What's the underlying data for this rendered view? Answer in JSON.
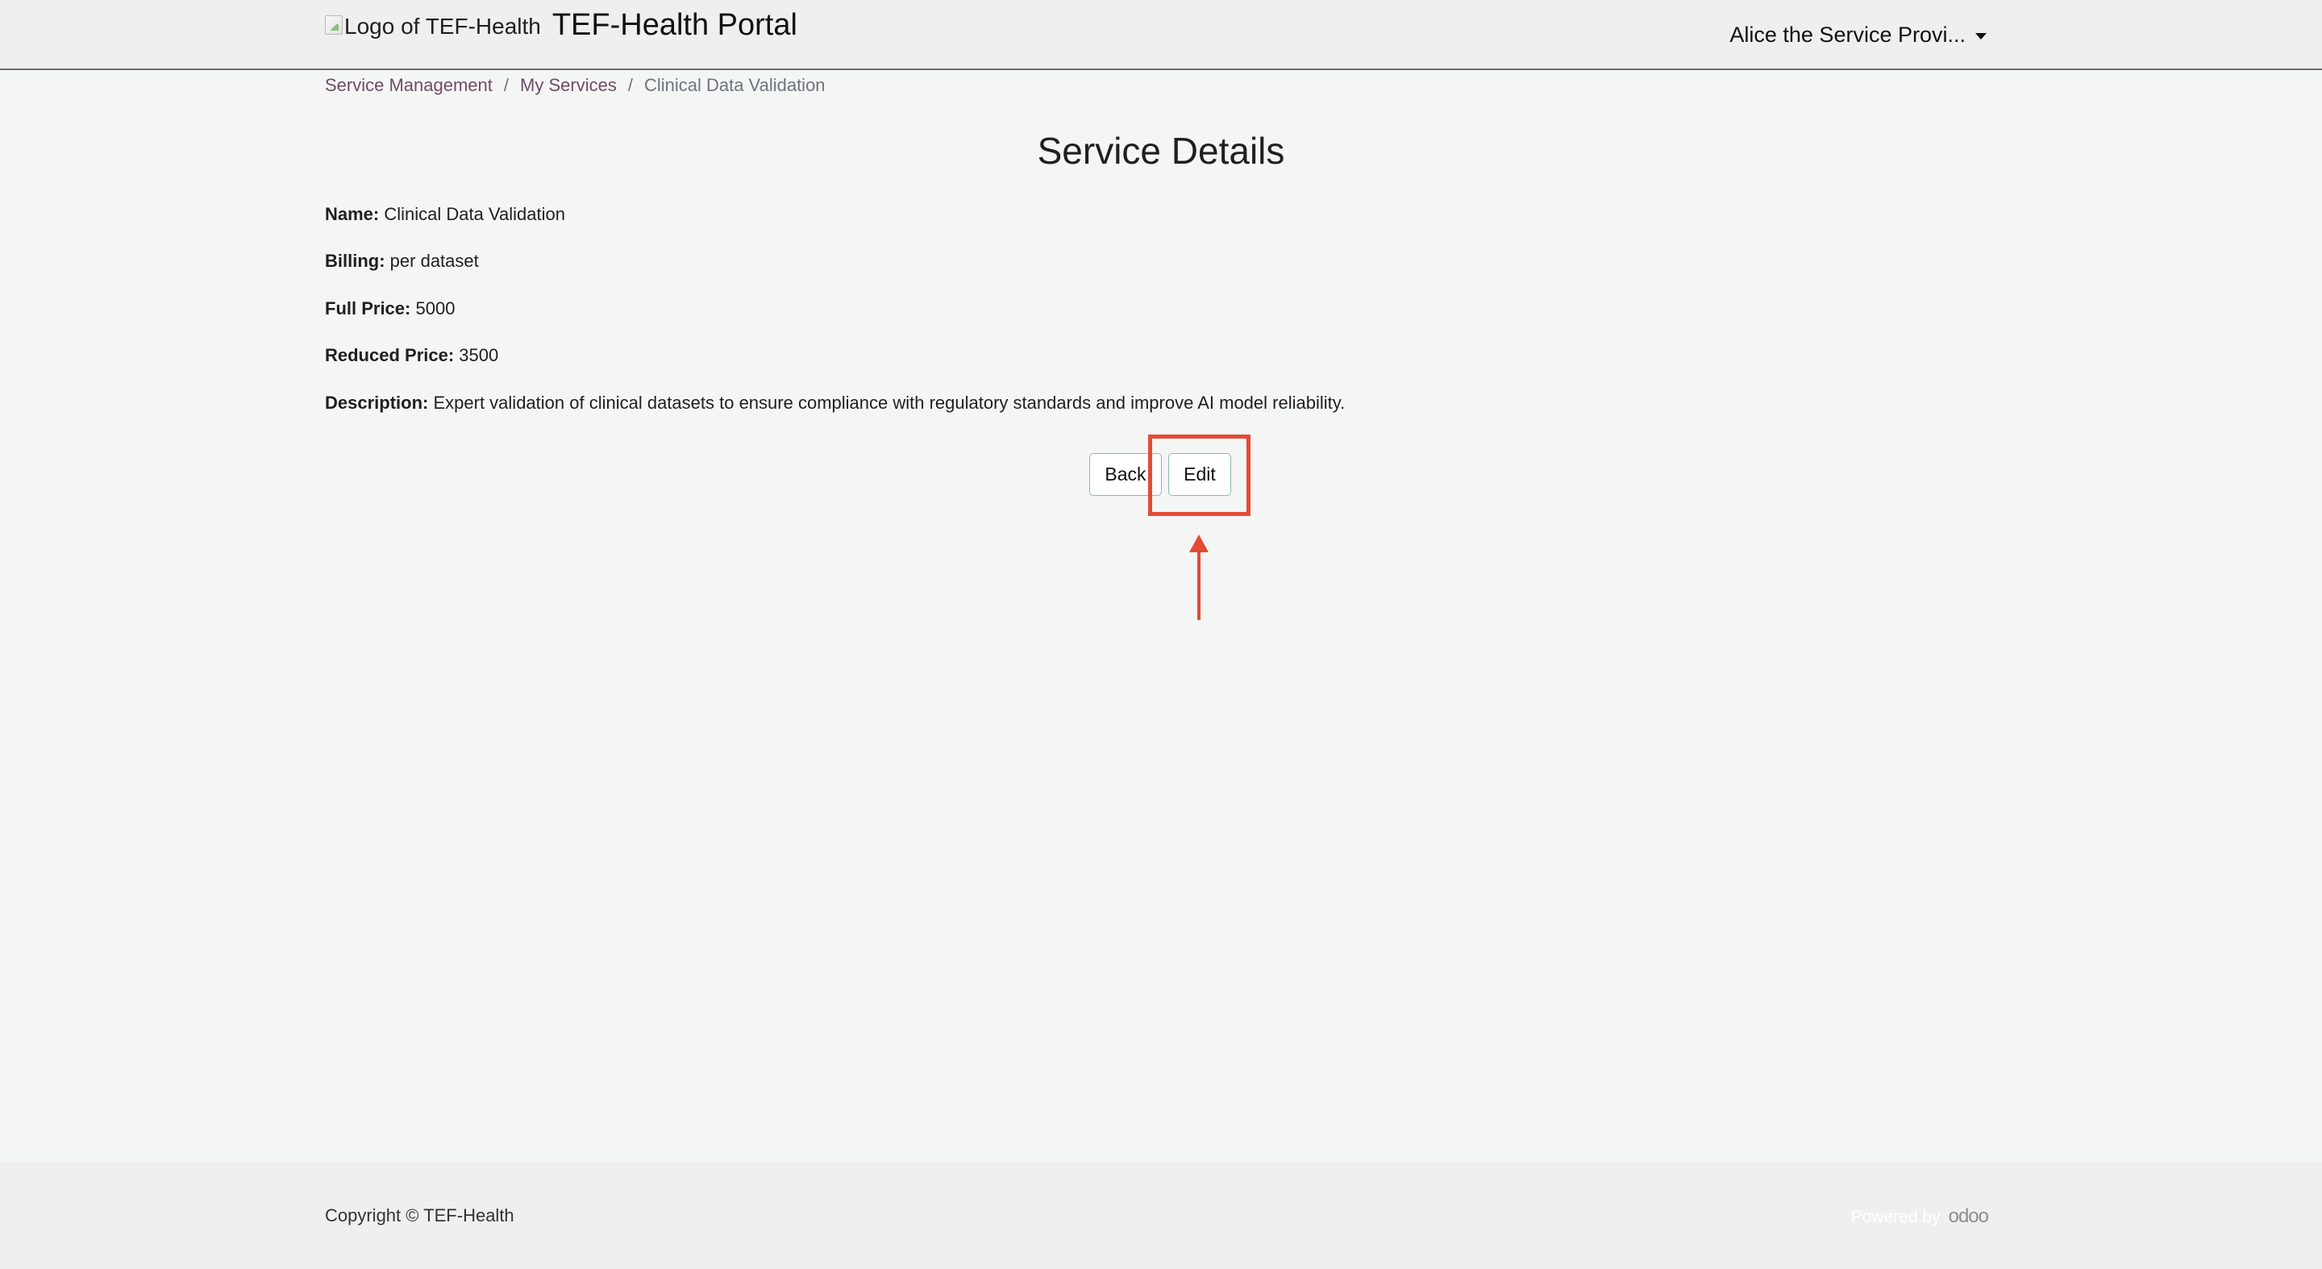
{
  "header": {
    "logo_alt": "Logo of TEF-Health",
    "title": "TEF-Health Portal",
    "user_menu": "Alice the Service Provi..."
  },
  "breadcrumb": {
    "items": [
      "Service Management",
      "My Services"
    ],
    "current": "Clinical Data Validation",
    "separator": "/"
  },
  "page": {
    "title": "Service Details"
  },
  "details": {
    "name_label": "Name:",
    "name_value": "Clinical Data Validation",
    "billing_label": "Billing:",
    "billing_value": "per dataset",
    "full_price_label": "Full Price:",
    "full_price_value": "5000",
    "reduced_price_label": "Reduced Price:",
    "reduced_price_value": "3500",
    "description_label": "Description:",
    "description_value": "Expert validation of clinical datasets to ensure compliance with regulatory standards and improve AI model reliability."
  },
  "actions": {
    "back_label": "Back",
    "edit_label": "Edit"
  },
  "footer": {
    "copyright": "Copyright © TEF-Health",
    "powered_by": "Powered by",
    "brand": "odoo"
  },
  "colors": {
    "link": "#714b67",
    "highlight": "#e54a33",
    "button_border": "#8bb7b3",
    "background": "#f4f6f5",
    "bar_background": "#efefef"
  },
  "icons": {
    "logo": "broken-image-icon",
    "user_menu": "caret-down-icon",
    "annotation": "arrow-up-icon"
  }
}
